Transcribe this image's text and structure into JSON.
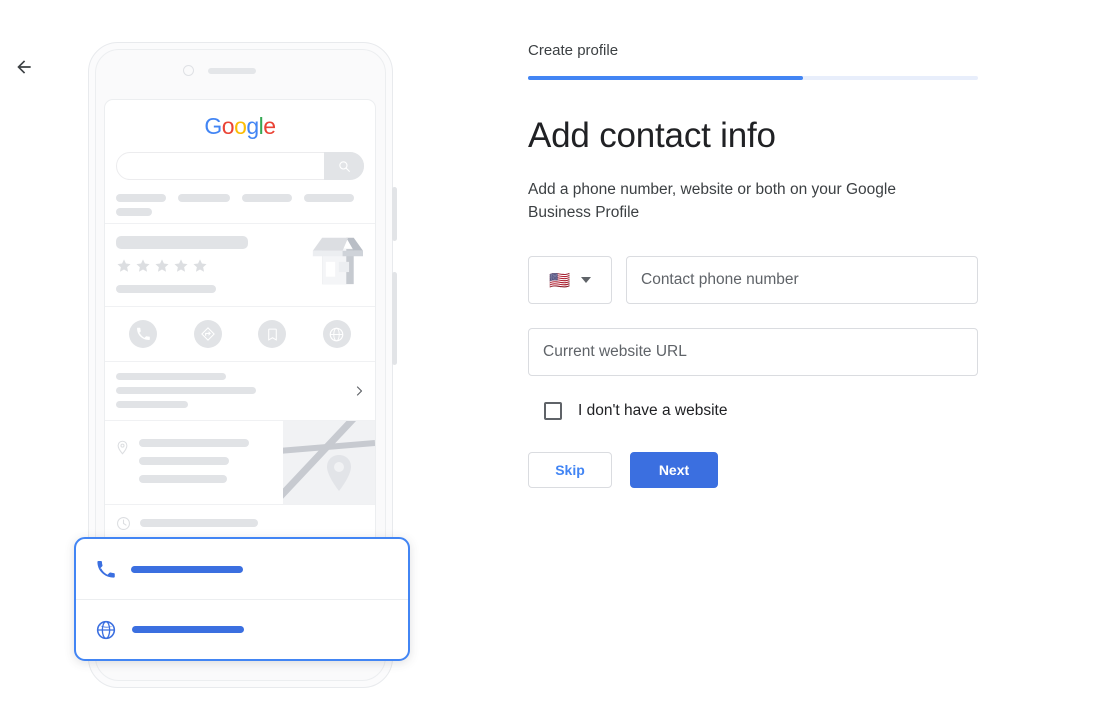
{
  "nav": {
    "back_icon": "arrow-left-icon"
  },
  "wizard": {
    "step_label": "Create profile",
    "progress_percent": 61
  },
  "page": {
    "title": "Add contact info",
    "subtitle": "Add a phone number, website or both on your Google Business Profile"
  },
  "form": {
    "country": {
      "flag": "🇺🇸",
      "caret_icon": "chevron-down-icon"
    },
    "phone": {
      "value": "",
      "placeholder": "Contact phone number"
    },
    "website": {
      "value": "",
      "placeholder": "Current website URL"
    },
    "no_website_checkbox": {
      "label": "I don't have a website",
      "checked": false
    }
  },
  "actions": {
    "skip_label": "Skip",
    "next_label": "Next"
  },
  "illustration": {
    "google_logo": [
      "G",
      "o",
      "o",
      "g",
      "l",
      "e"
    ],
    "search_icon": "search-icon",
    "store_icon": "storefront-icon",
    "star_count": 5,
    "action_icons": [
      "call-icon",
      "directions-icon",
      "save-icon",
      "website-icon"
    ],
    "chevron_icon": "chevron-right-icon",
    "location_icon": "location-pin-icon",
    "clock_icon": "clock-icon",
    "map_pin_icon": "map-pin-icon",
    "highlight_rows": [
      "call-icon",
      "website-icon"
    ]
  },
  "colors": {
    "accent": "#4285F4",
    "button_blue": "#3b6fe0",
    "google_blue": "#4285F4",
    "google_red": "#EA4335",
    "google_yellow": "#FBBC05",
    "google_green": "#34A853",
    "border": "#dadce0",
    "placeholder_gray": "#e1e3e6",
    "text_primary": "#202124",
    "text_secondary": "#3c4043"
  }
}
